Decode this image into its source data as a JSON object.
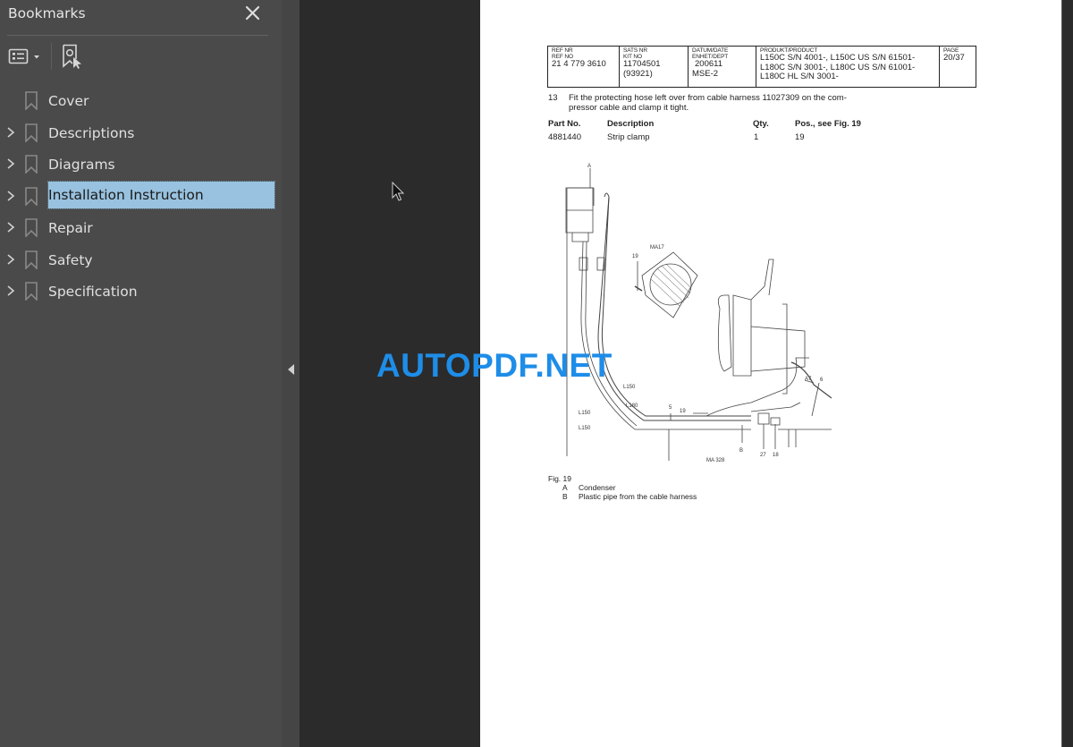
{
  "sidebar": {
    "title": "Bookmarks",
    "close_label": "close-bookmarks",
    "items": [
      {
        "label": "Cover",
        "expandable": false,
        "selected": false
      },
      {
        "label": "Descriptions",
        "expandable": true,
        "selected": false
      },
      {
        "label": "Diagrams",
        "expandable": true,
        "selected": false
      },
      {
        "label": "Installation Instruction",
        "expandable": true,
        "selected": true
      },
      {
        "label": "Repair",
        "expandable": true,
        "selected": false
      },
      {
        "label": "Safety",
        "expandable": true,
        "selected": false
      },
      {
        "label": "Specification",
        "expandable": true,
        "selected": false
      }
    ]
  },
  "document": {
    "header": {
      "ref": {
        "label1": "REF NR",
        "label2": "REF NO",
        "value": "21 4 779 3610"
      },
      "kit": {
        "label1": "SATS NR",
        "label2": "KIT NO",
        "value1": "11704501",
        "value2": "(93921)"
      },
      "date": {
        "label1": "DATUM/DATE",
        "label2": "ENHET/DEPT",
        "value1": "200611",
        "value2": "MSE-2"
      },
      "product": {
        "label": "PRODUKT/PRODUCT",
        "lines": [
          "L150C S/N 4001-, L150C US S/N 61501-",
          "L180C S/N 3001-, L180C US S/N 61001-",
          "L180C HL S/N 3001-"
        ]
      },
      "page": {
        "label": "PAGE",
        "value": "20/37"
      }
    },
    "step": {
      "number": "13",
      "line1": "Fit the protecting hose left over from cable harness 11027309 on the com-",
      "line2": "pressor cable and clamp it tight."
    },
    "parts_table": {
      "headers": [
        "Part No.",
        "Description",
        "Qty.",
        "Pos., see Fig. 19"
      ],
      "rows": [
        [
          "4881440",
          "Strip clamp",
          "1",
          "19"
        ]
      ]
    },
    "figure": {
      "labels": {
        "A": "A",
        "ma17": "MA17",
        "pos19": "19",
        "pos19b": "19",
        "l150a": "L150",
        "l180": "L180",
        "l150b": "L150",
        "l150c": "L150",
        "pos5": "5",
        "pos7": "7",
        "B": "B",
        "pos27": "27",
        "pos18": "18",
        "A7": "A7",
        "pos6": "6",
        "code": "MA 328"
      },
      "caption": "Fig. 19",
      "legend": [
        {
          "key": "A",
          "text": "Condenser"
        },
        {
          "key": "B",
          "text": "Plastic pipe from the cable harness"
        }
      ]
    }
  },
  "watermark": "AUTOPDF.NET",
  "colors": {
    "sidebar_bg": "#4a4a4a",
    "viewer_bg": "#2b2b2b",
    "selection": "#98c2df",
    "watermark": "#1e8de8"
  }
}
